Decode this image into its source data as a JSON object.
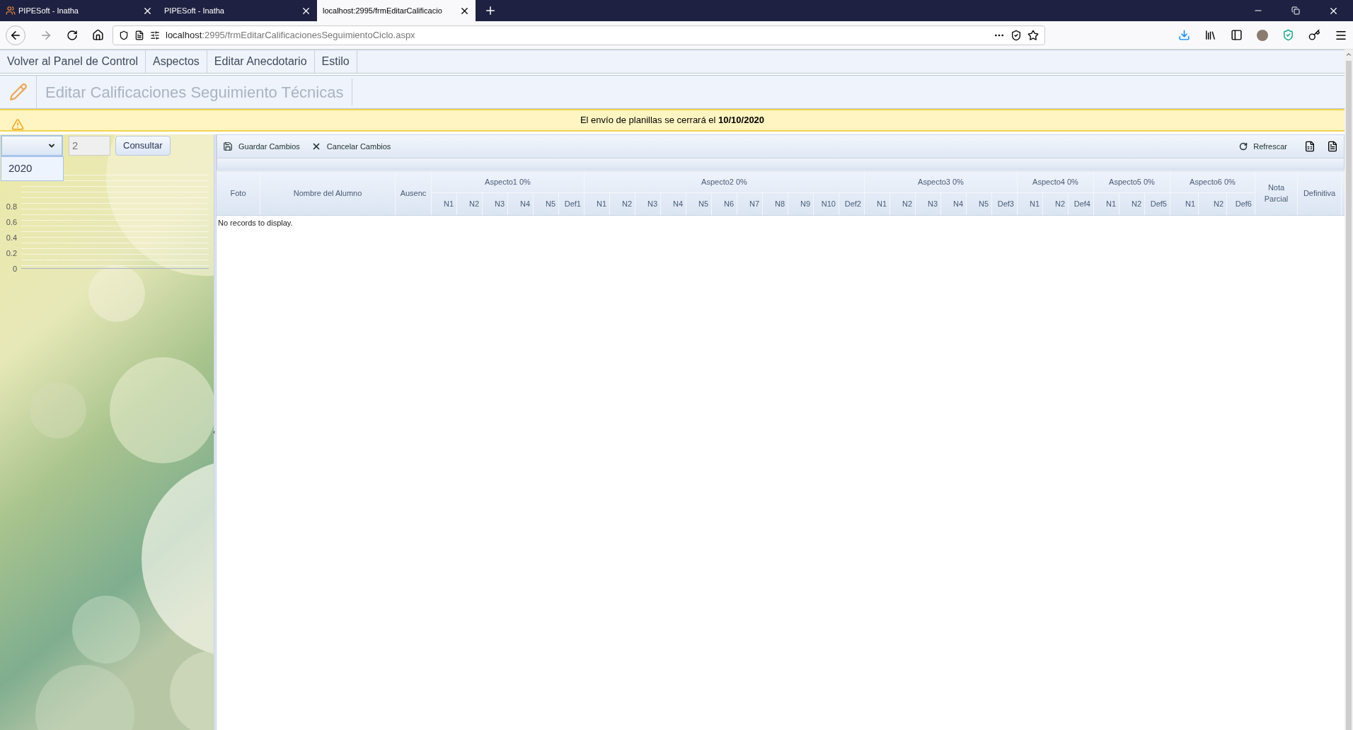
{
  "browser": {
    "tabs": [
      {
        "title": "PIPESoft - Inatha",
        "selected": false,
        "has_icon": true
      },
      {
        "title": "PIPESoft - Inatha",
        "selected": false,
        "has_icon": false
      },
      {
        "title": "localhost:2995/frmEditarCalificacio",
        "selected": true,
        "has_icon": false
      }
    ],
    "address": {
      "host": "localhost",
      "rest": ":2995/frmEditarCalificacionesSeguimientoCiclo.aspx"
    }
  },
  "menu": [
    "Volver al Panel de Control",
    "Aspectos",
    "Editar Anecdotario",
    "Estilo"
  ],
  "page_title": "Editar Calificaciones Seguimiento Técnicas",
  "notice": "El envío de planillas se cerrará el **10/10/2020**",
  "filters": {
    "year_options": [
      "2020"
    ],
    "period": "2",
    "query_button": "Consultar"
  },
  "chart_axis_labels": [
    "0.8",
    "0.6",
    "0.4",
    "0.2",
    "0"
  ],
  "toolbar": {
    "save": "Guardar Cambios",
    "cancel": "Cancelar Cambios",
    "refresh": "Refrescar"
  },
  "grid": {
    "columns": [
      {
        "kind": "single",
        "label": "Foto"
      },
      {
        "kind": "single",
        "label": "Nombre del Alumno"
      },
      {
        "kind": "single",
        "label": "Ausenc"
      },
      {
        "kind": "group",
        "label": "Aspecto1 0%",
        "subcolumns": [
          "N1",
          "N2",
          "N3",
          "N4",
          "N5",
          "Def1"
        ]
      },
      {
        "kind": "group",
        "label": "Aspecto2 0%",
        "subcolumns": [
          "N1",
          "N2",
          "N3",
          "N4",
          "N5",
          "N6",
          "N7",
          "N8",
          "N9",
          "N10",
          "Def2"
        ]
      },
      {
        "kind": "group",
        "label": "Aspecto3 0%",
        "subcolumns": [
          "N1",
          "N2",
          "N3",
          "N4",
          "N5",
          "Def3"
        ]
      },
      {
        "kind": "group",
        "label": "Aspecto4 0%",
        "subcolumns": [
          "N1",
          "N2",
          "Def4"
        ]
      },
      {
        "kind": "group",
        "label": "Aspecto5 0%",
        "subcolumns": [
          "N1",
          "N2",
          "Def5"
        ]
      },
      {
        "kind": "group",
        "label": "Aspecto6 0%",
        "subcolumns": [
          "N1",
          "N2",
          "Def6"
        ]
      },
      {
        "kind": "single",
        "label": "Nota Parcial"
      },
      {
        "kind": "single",
        "label": "Definitiva"
      }
    ],
    "empty_message": "No records to display."
  }
}
